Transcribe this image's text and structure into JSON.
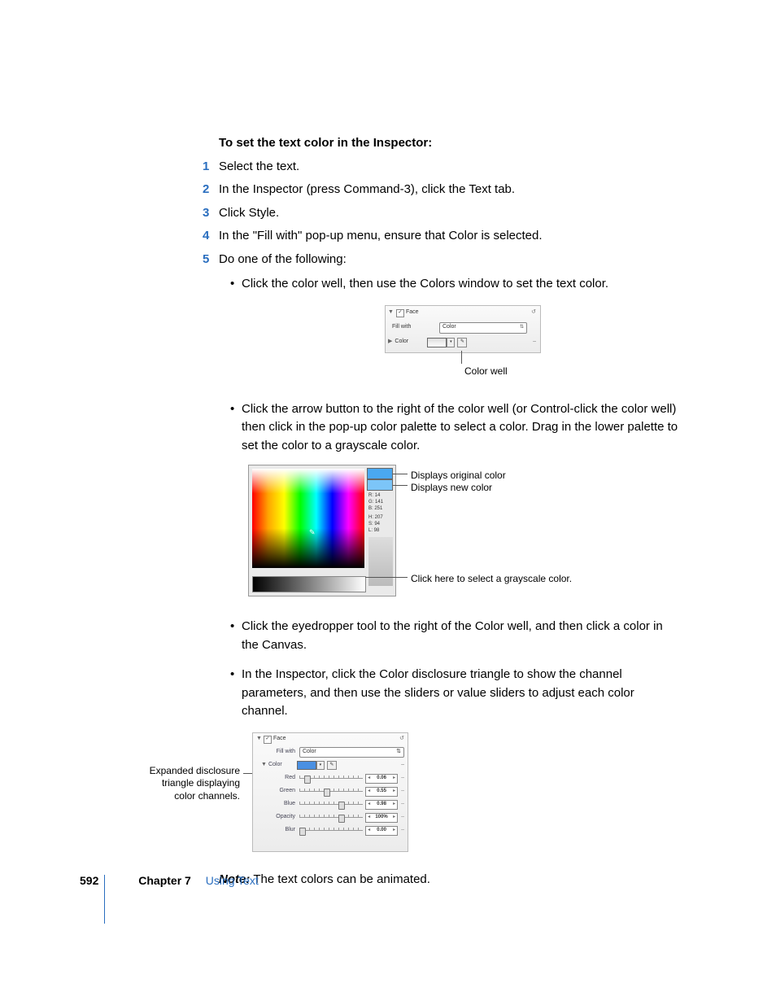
{
  "heading": "To set the text color in the Inspector:",
  "steps": [
    "Select the text.",
    "In the Inspector (press Command-3), click the Text tab.",
    "Click Style.",
    "In the \"Fill with\" pop-up menu, ensure that Color is selected.",
    "Do one of the following:"
  ],
  "bullets": [
    "Click the color well, then use the Colors window to set the text color.",
    "Click the arrow button to the right of the color well (or Control-click the color well) then click in the pop-up color palette to select a color. Drag in the lower palette to set the color to a grayscale color.",
    "Click the eyedropper tool to the right of the Color well, and then click a color in the Canvas.",
    "In the Inspector, click the Color disclosure triangle to show the channel parameters, and then use the sliders or value sliders to adjust each color channel."
  ],
  "fig1": {
    "face": "Face",
    "fillwith": "Fill with",
    "select": "Color",
    "color": "Color",
    "caption": "Color well"
  },
  "fig2": {
    "c1": "Displays original color",
    "c2": "Displays new color",
    "c3": "Click here to select a grayscale color.",
    "rgb": {
      "R": "14",
      "G": "141",
      "B": "251"
    },
    "hsl": {
      "H": "207",
      "S": "94",
      "L": "98"
    }
  },
  "fig3": {
    "side": "Expanded disclosure triangle displaying color channels.",
    "face": "Face",
    "fillwith": "Fill with",
    "select": "Color",
    "color": "Color",
    "channels": [
      {
        "name": "Red",
        "value": "0.06",
        "thumb": 6
      },
      {
        "name": "Green",
        "value": "0.55",
        "thumb": 30
      },
      {
        "name": "Blue",
        "value": "0.98",
        "thumb": 48
      }
    ],
    "opacity": {
      "name": "Opacity",
      "value": "100%",
      "thumb": 48
    },
    "blur": {
      "name": "Blur",
      "value": "0.00",
      "thumb": 0
    }
  },
  "note_label": "Note:",
  "note_text": "The text colors can be animated.",
  "footer": {
    "page": "592",
    "chapter": "Chapter 7",
    "title": "Using Text"
  }
}
